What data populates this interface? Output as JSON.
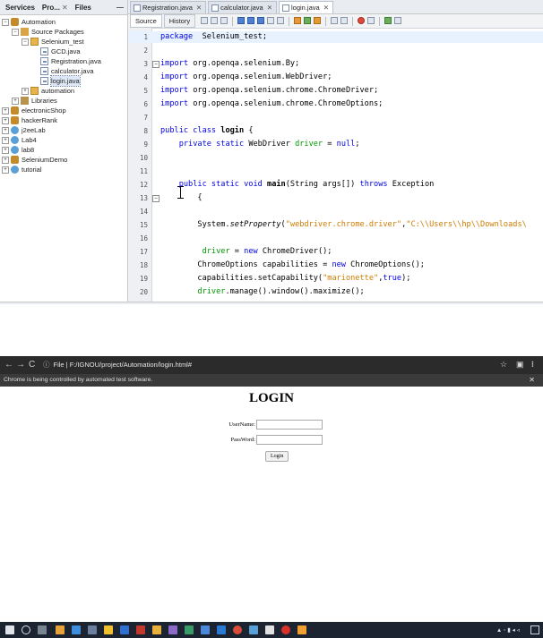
{
  "ide": {
    "panel_tabs": [
      {
        "label": "Services",
        "closable": false
      },
      {
        "label": "Pro...",
        "closable": true
      },
      {
        "label": "Files",
        "closable": false
      }
    ],
    "panel_minimize": "—",
    "tree": [
      {
        "label": "Automation",
        "icon": "project-icon",
        "toggle": "−",
        "level": 0
      },
      {
        "label": "Source Packages",
        "icon": "folder-icon",
        "toggle": "−",
        "level": 1
      },
      {
        "label": "Selenium_test",
        "icon": "package-icon",
        "toggle": "−",
        "level": 2
      },
      {
        "label": "GCD.java",
        "icon": "java-file-icon",
        "toggle": "",
        "level": 3
      },
      {
        "label": "Registration.java",
        "icon": "java-file-icon",
        "toggle": "",
        "level": 3
      },
      {
        "label": "calculator.java",
        "icon": "java-file-icon",
        "toggle": "",
        "level": 3
      },
      {
        "label": "login.java",
        "icon": "java-file-icon",
        "toggle": "",
        "level": 3,
        "selected": true
      },
      {
        "label": "automation",
        "icon": "package-icon",
        "toggle": "+",
        "level": 2
      },
      {
        "label": "Libraries",
        "icon": "library-icon",
        "toggle": "+",
        "level": 1
      },
      {
        "label": "electronicShop",
        "icon": "project-icon",
        "toggle": "+",
        "level": 0
      },
      {
        "label": "hackerRank",
        "icon": "project-icon",
        "toggle": "+",
        "level": 0
      },
      {
        "label": "j2eeLab",
        "icon": "globe-icon",
        "toggle": "+",
        "level": 0
      },
      {
        "label": "Lab4",
        "icon": "globe-icon",
        "toggle": "+",
        "level": 0
      },
      {
        "label": "lab8",
        "icon": "globe-icon",
        "toggle": "+",
        "level": 0
      },
      {
        "label": "SeleniumDemo",
        "icon": "project-icon",
        "toggle": "+",
        "level": 0
      },
      {
        "label": "tutorial",
        "icon": "globe-icon",
        "toggle": "+",
        "level": 0
      }
    ],
    "file_tabs": [
      {
        "label": "Registration.java",
        "active": false
      },
      {
        "label": "calculator.java",
        "active": false
      },
      {
        "label": "login.java",
        "active": true
      }
    ],
    "toolbar": {
      "source_label": "Source",
      "history_label": "History"
    },
    "code_lines": [
      {
        "n": "1",
        "fold": "",
        "parts": [
          [
            "kw",
            "package"
          ],
          [
            "",
            "  Selenium_test;"
          ]
        ],
        "cur": true
      },
      {
        "n": "2",
        "fold": "",
        "parts": []
      },
      {
        "n": "3",
        "fold": "−",
        "parts": [
          [
            "kw",
            "import"
          ],
          [
            "",
            " org.openqa.selenium.By;"
          ]
        ]
      },
      {
        "n": "4",
        "fold": "",
        "parts": [
          [
            "kw",
            "import"
          ],
          [
            "",
            " org.openqa.selenium.WebDriver;"
          ]
        ]
      },
      {
        "n": "5",
        "fold": "",
        "parts": [
          [
            "kw",
            "import"
          ],
          [
            "",
            " org.openqa.selenium.chrome.ChromeDriver;"
          ]
        ]
      },
      {
        "n": "6",
        "fold": "",
        "parts": [
          [
            "kw",
            "import"
          ],
          [
            "",
            " org.openqa.selenium.chrome.ChromeOptions;"
          ]
        ]
      },
      {
        "n": "7",
        "fold": "",
        "parts": []
      },
      {
        "n": "8",
        "fold": "",
        "parts": [
          [
            "kw",
            "public class "
          ],
          [
            "bold",
            "login"
          ],
          [
            "",
            " {"
          ]
        ]
      },
      {
        "n": "9",
        "fold": "",
        "parts": [
          [
            "",
            "    "
          ],
          [
            "kw",
            "private static"
          ],
          [
            "",
            " WebDriver "
          ],
          [
            "fld",
            "driver"
          ],
          [
            "",
            " = "
          ],
          [
            "kw",
            "null"
          ],
          [
            ";"
          ]
        ]
      },
      {
        "n": "10",
        "fold": "",
        "parts": []
      },
      {
        "n": "11",
        "fold": "",
        "parts": []
      },
      {
        "n": "12",
        "fold": "",
        "parts": [
          [
            "",
            "    "
          ],
          [
            "kw",
            "public static void "
          ],
          [
            "bold",
            "main"
          ],
          [
            "",
            "(String args[]) "
          ],
          [
            "kw",
            "throws"
          ],
          [
            "",
            " Exception"
          ]
        ]
      },
      {
        "n": "13",
        "fold": "−",
        "parts": [
          [
            "",
            "        {"
          ]
        ]
      },
      {
        "n": "14",
        "fold": "",
        "parts": []
      },
      {
        "n": "15",
        "fold": "",
        "parts": [
          [
            "",
            "        System."
          ],
          [
            "ital",
            "setProperty"
          ],
          [
            "",
            "("
          ],
          [
            "str",
            "\"webdriver.chrome.driver\""
          ],
          [
            "",
            ","
          ],
          [
            "str",
            "\"C:\\\\Users\\\\hp\\\\Downloads\\"
          ]
        ]
      },
      {
        "n": "16",
        "fold": "",
        "parts": []
      },
      {
        "n": "17",
        "fold": "",
        "parts": [
          [
            "",
            "         "
          ],
          [
            "fld",
            "driver"
          ],
          [
            "",
            " = "
          ],
          [
            "kw",
            "new"
          ],
          [
            "",
            " ChromeDriver();"
          ]
        ]
      },
      {
        "n": "18",
        "fold": "",
        "parts": [
          [
            "",
            "        ChromeOptions capabilities = "
          ],
          [
            "kw",
            "new"
          ],
          [
            "",
            " ChromeOptions();"
          ]
        ]
      },
      {
        "n": "19",
        "fold": "",
        "parts": [
          [
            "",
            "        capabilities.setCapability("
          ],
          [
            "str",
            "\"marionette\""
          ],
          [
            "",
            ","
          ],
          [
            "kw",
            "true"
          ],
          [
            "",
            ");"
          ]
        ]
      },
      {
        "n": "20",
        "fold": "",
        "parts": [
          [
            "",
            "        "
          ],
          [
            "fld",
            "driver"
          ],
          [
            "",
            ".manage().window().maximize();"
          ]
        ]
      }
    ]
  },
  "chrome": {
    "url_prefix": "File",
    "url": "F:/IGNOU/project/Automation/login.html#",
    "automation_notice": "Chrome is being controlled by automated test software.",
    "page": {
      "title": "LOGIN",
      "username_label": "UserName:",
      "password_label": "PassWord:",
      "login_button": "Login"
    }
  },
  "colors": {
    "keyword": "#0000e6",
    "string": "#ce7b00",
    "field": "#009900",
    "chrome_bar": "#2b2b2b",
    "taskbar": "#1b2430"
  }
}
